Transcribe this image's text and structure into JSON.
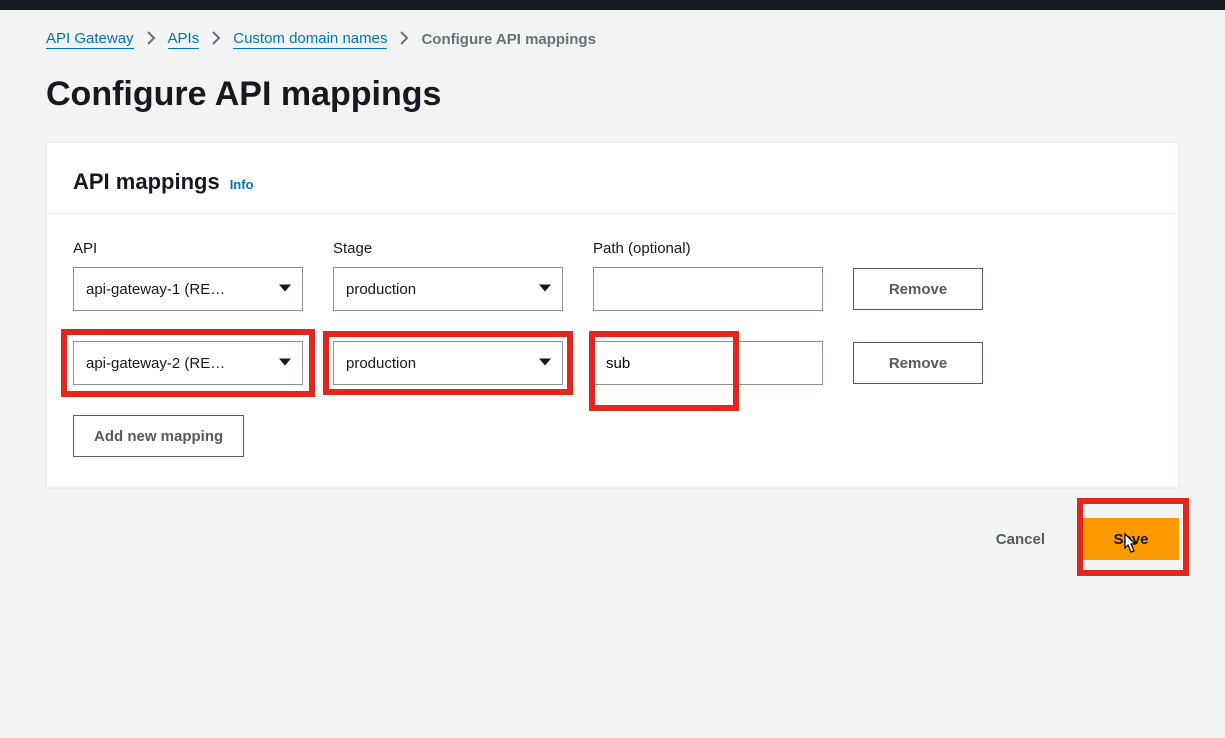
{
  "breadcrumb": {
    "api_gateway": "API Gateway",
    "apis": "APIs",
    "custom": "Custom domain names",
    "current": "Configure API mappings"
  },
  "page_title": "Configure API mappings",
  "panel": {
    "title": "API mappings",
    "info": "Info"
  },
  "columns": {
    "api": "API",
    "stage": "Stage",
    "path": "Path (optional)"
  },
  "rows": [
    {
      "api": "api-gateway-1 (RE…",
      "stage": "production",
      "path": "",
      "remove": "Remove"
    },
    {
      "api": "api-gateway-2 (RE…",
      "stage": "production",
      "path": "sub",
      "remove": "Remove"
    }
  ],
  "add_new": "Add new mapping",
  "footer": {
    "cancel": "Cancel",
    "save": "Save"
  }
}
